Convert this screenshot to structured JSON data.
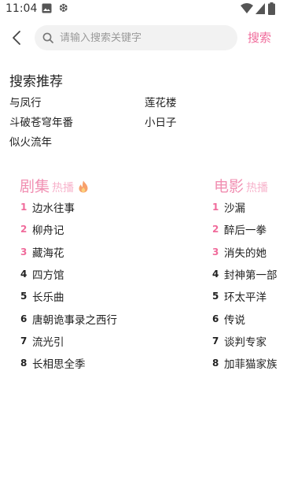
{
  "status": {
    "time": "11:04",
    "icons": [
      "image-icon",
      "app-notification-icon",
      "wifi-icon",
      "cellular-icon",
      "battery-icon"
    ]
  },
  "search": {
    "placeholder": "请输入搜索关键字",
    "value": "",
    "submit_label": "搜索"
  },
  "recommend": {
    "title": "搜索推荐",
    "items": [
      "与凤行",
      "莲花楼",
      "斗破苍穹年番",
      "小日子",
      "似火流年"
    ]
  },
  "series_ranking": {
    "title": "剧集",
    "subtitle": "热播",
    "items": [
      "边水往事",
      "柳舟记",
      "藏海花",
      "四方馆",
      "长乐曲",
      "唐朝诡事录之西行",
      "流光引",
      "长相思全季"
    ]
  },
  "movie_ranking": {
    "title": "电影",
    "subtitle": "热播",
    "items": [
      "沙漏",
      "醉后一拳",
      "消失的她",
      "封神第一部",
      "环太平洋",
      "传说",
      "谈判专家",
      "加菲猫家族"
    ]
  },
  "ranks": [
    "1",
    "2",
    "3",
    "4",
    "5",
    "6",
    "7",
    "8"
  ],
  "colors": {
    "accent": "#f06b9b",
    "section_title": "#f18fb2",
    "search_bg": "#f2f2f2"
  }
}
